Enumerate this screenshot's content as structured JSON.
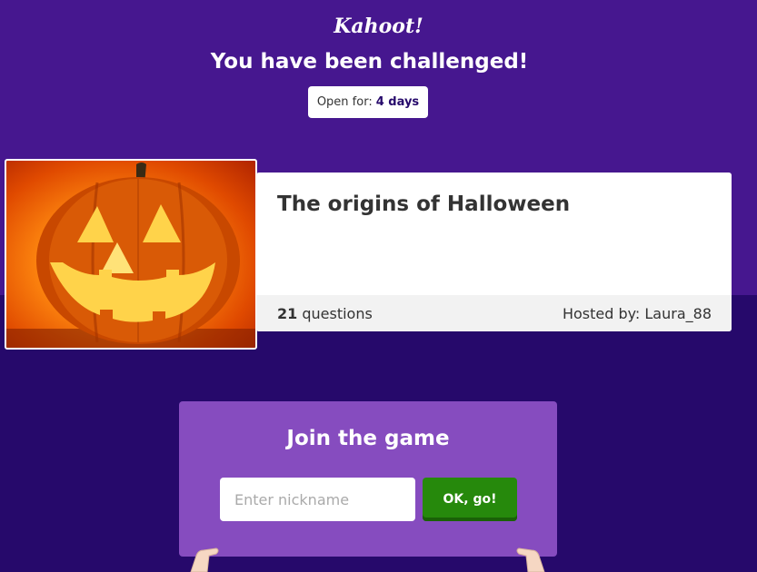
{
  "brand": {
    "logo_text": "Kahoot!"
  },
  "header": {
    "title": "You have been challenged!",
    "open_label": "Open for:",
    "open_value": "4 days"
  },
  "card": {
    "title": "The origins of Halloween",
    "question_count": "21",
    "questions_label": "questions",
    "hosted_by": "Hosted by: Laura_88",
    "image": "jack-o-lantern"
  },
  "join": {
    "title": "Join the game",
    "nickname_placeholder": "Enter nickname",
    "nickname_value": "",
    "button_label": "OK, go!"
  },
  "colors": {
    "bg_top": "#46178f",
    "bg_bottom": "#26096b",
    "panel": "#864cbf",
    "button": "#26890c"
  }
}
